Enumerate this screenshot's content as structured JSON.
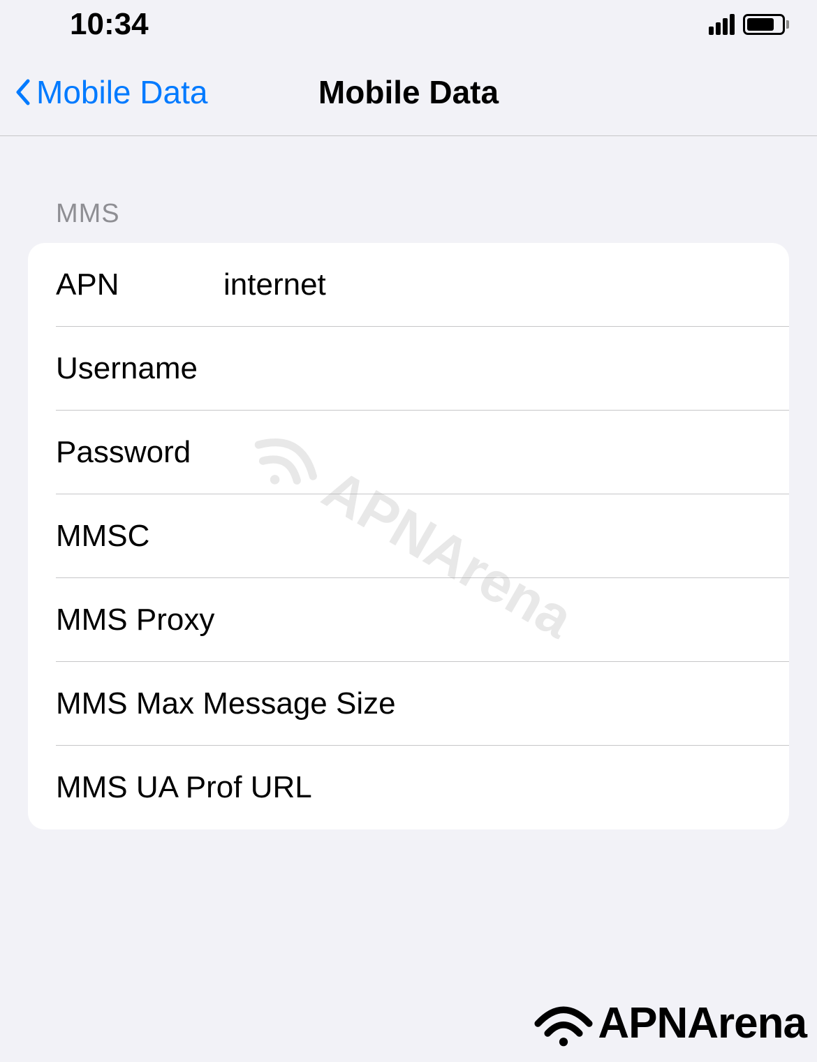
{
  "status_bar": {
    "time": "10:34"
  },
  "navigation": {
    "back_label": "Mobile Data",
    "title": "Mobile Data"
  },
  "section": {
    "header": "MMS",
    "fields": {
      "apn": {
        "label": "APN",
        "value": "internet"
      },
      "username": {
        "label": "Username",
        "value": ""
      },
      "password": {
        "label": "Password",
        "value": ""
      },
      "mmsc": {
        "label": "MMSC",
        "value": ""
      },
      "mms_proxy": {
        "label": "MMS Proxy",
        "value": ""
      },
      "mms_max_size": {
        "label": "MMS Max Message Size",
        "value": ""
      },
      "mms_ua_prof": {
        "label": "MMS UA Prof URL",
        "value": ""
      }
    }
  },
  "watermark": {
    "text": "APNArena"
  },
  "branding": {
    "text": "APNArena"
  }
}
